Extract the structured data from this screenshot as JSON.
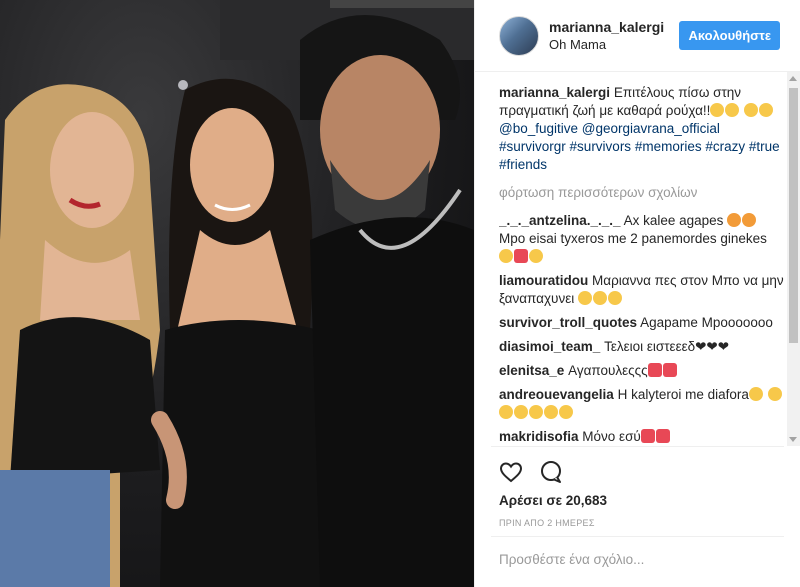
{
  "post": {
    "username": "marianna_kalergi",
    "location": "Oh Mama",
    "follow_label": "Ακολουθήστε",
    "caption": {
      "user": "marianna_kalergi",
      "text": "Επιτέλους πίσω στην πραγματική ζωή με καθαρά ρούχα!!",
      "mentions": [
        "@bo_fugitive",
        "@georgiavrana_official"
      ],
      "hashtags": [
        "#survivorgr",
        "#survivors",
        "#memories",
        "#crazy",
        "#true",
        "#friends"
      ]
    },
    "load_more": "φόρτωση περισσότερων σχολίων",
    "comments": [
      {
        "user": "_._._antzelina._._._",
        "text": "Ax kalee agapes",
        "text2": "Mpo eisai tyxeros me 2 panemordes ginekes"
      },
      {
        "user": "liamouratidou",
        "text": "Μαριαννα πες στον Μπο να μην ξαναπαχυνει"
      },
      {
        "user": "survivor_troll_quotes",
        "text": "Agapame Mpooooooo"
      },
      {
        "user": "diasimoi_team_",
        "text": "Τελειοι ειστεεεδ"
      },
      {
        "user": "elenitsa_e",
        "text": "Αγαπουλεςςς"
      },
      {
        "user": "andreouevangelia",
        "text": "H kalyteroi me diafora"
      },
      {
        "user": "makridisofia",
        "text": "Μόνο εσύ"
      }
    ],
    "likes": "Αρέσει σε 20,683",
    "timestamp": "ΠΡΙΝ ΑΠΟ 2 ΗΜΕΡΕΣ",
    "add_comment_placeholder": "Προσθέστε ένα σχόλιο..."
  },
  "icons": {
    "like": "heart-icon",
    "comment": "comment-icon"
  },
  "colors": {
    "follow_button": "#3897f0",
    "link": "#003569",
    "muted": "#999999"
  }
}
